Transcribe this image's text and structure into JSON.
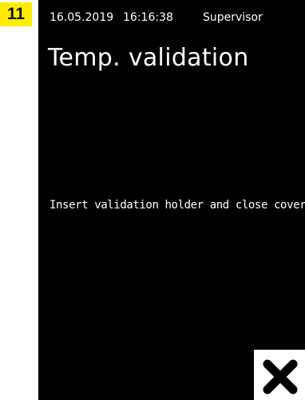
{
  "step": {
    "number": "11"
  },
  "status_bar": {
    "date": "16.05.2019",
    "time": "16:16:38",
    "user": "Supervisor"
  },
  "screen": {
    "title": "Temp. validation",
    "message": "Insert validation holder and close cover"
  },
  "close_button": {
    "icon": "close-icon"
  },
  "colors": {
    "badge": "#ffec00",
    "screen_bg": "#000000",
    "text": "#ffffff",
    "button_bg": "#ffffff",
    "icon": "#000000"
  }
}
